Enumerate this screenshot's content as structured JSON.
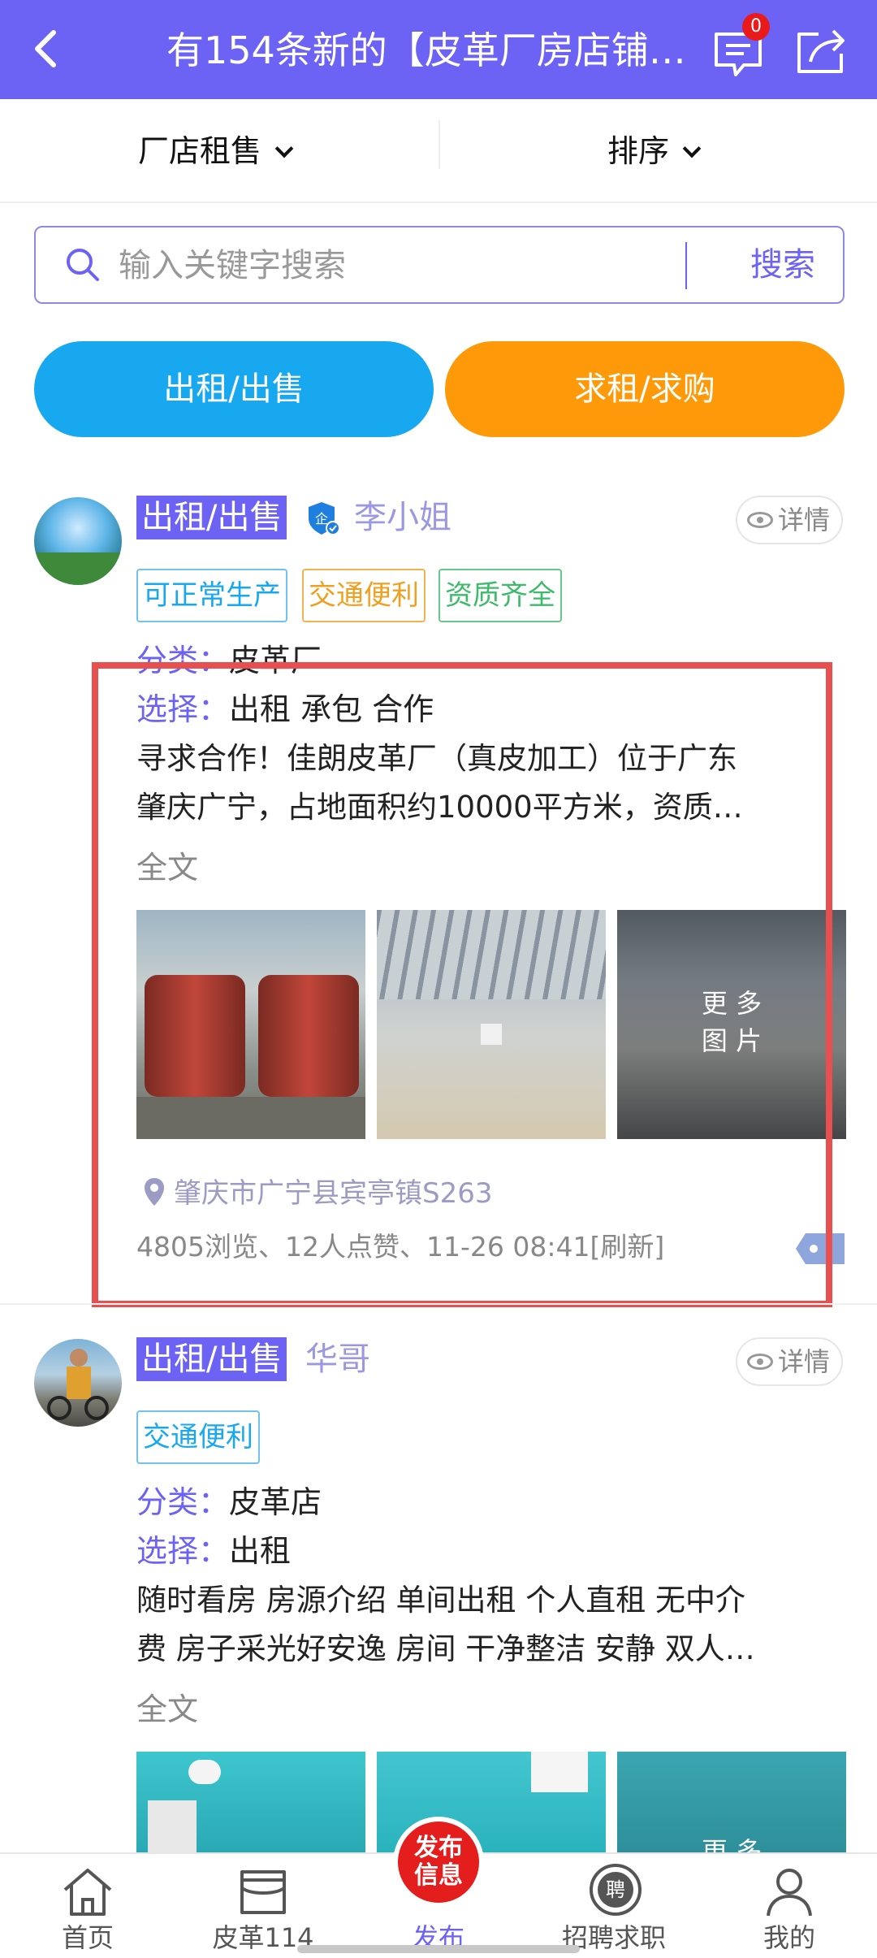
{
  "header": {
    "title": "有154条新的【皮革厂房店铺…",
    "message_badge": "0",
    "bg_color": "#6c63f5"
  },
  "filters": {
    "left": "厂店租售",
    "right": "排序"
  },
  "search": {
    "placeholder": "输入关键字搜索",
    "button": "搜索"
  },
  "actions": {
    "rent_sell": "出租/出售",
    "seek": "求租/求购"
  },
  "posts": [
    {
      "type_tag": "出租/出售",
      "name": "李小姐",
      "verified": true,
      "detail": "详情",
      "features": [
        "可正常生产",
        "交通便利",
        "资质齐全"
      ],
      "category_label": "分类：",
      "category": "皮革厂",
      "choice_label": "选择：",
      "choice": "出租 承包 合作",
      "desc_lines": [
        "寻求合作！佳朗皮革厂（真皮加工）位于广东",
        "肇庆广宁，占地面积约10000平方米，资质…"
      ],
      "full_text": "全文",
      "more_images": [
        "更 多",
        "图 片"
      ],
      "location": "肇庆市广宁县宾亭镇S263",
      "stats": "4805浏览、12人点赞、11-26 08:41[刷新]"
    },
    {
      "type_tag": "出租/出售",
      "name": "华哥",
      "detail": "详情",
      "features": [
        "交通便利"
      ],
      "category_label": "分类：",
      "category": "皮革店",
      "choice_label": "选择：",
      "choice": "出租",
      "desc_lines": [
        "随时看房 房源介绍 单间出租 个人直租 无中介",
        "费 房子采光好安逸 房间 干净整洁 安静 双人…"
      ],
      "full_text": "全文",
      "more_images": [
        "更 多"
      ]
    }
  ],
  "tabbar": {
    "home": "首页",
    "leather114": "皮革114",
    "publish": "发布",
    "publish_badge": [
      "发布",
      "信息"
    ],
    "jobs": "招聘求职",
    "mine": "我的",
    "jobs_badge": "聘"
  }
}
